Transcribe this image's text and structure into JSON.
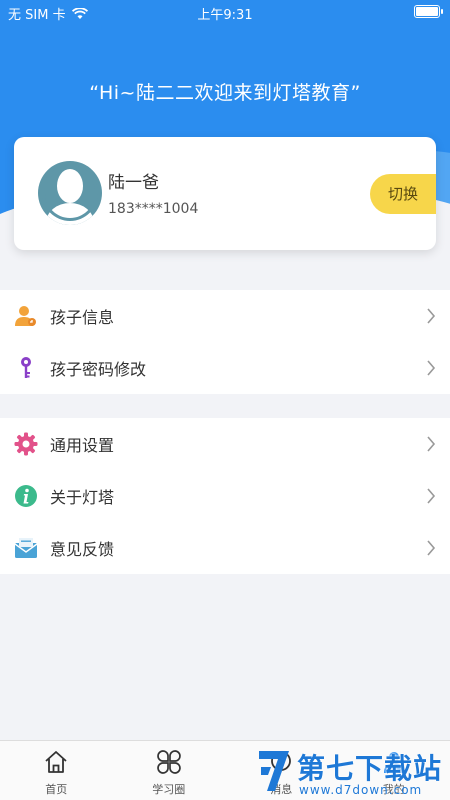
{
  "status_bar": {
    "carrier": "无 SIM 卡",
    "time": "上午9:31"
  },
  "header": {
    "welcome": "“Hi~陆二二欢迎来到灯塔教育”"
  },
  "profile": {
    "name": "陆一爸",
    "phone": "183****1004",
    "switch_label": "切换"
  },
  "menu_group_1": [
    {
      "label": "孩子信息",
      "icon": "child-info-icon"
    },
    {
      "label": "孩子密码修改",
      "icon": "key-icon"
    }
  ],
  "menu_group_2": [
    {
      "label": "通用设置",
      "icon": "gear-icon"
    },
    {
      "label": "关于灯塔",
      "icon": "info-icon"
    },
    {
      "label": "意见反馈",
      "icon": "feedback-icon"
    }
  ],
  "tabs": [
    {
      "label": "首页",
      "icon": "home-icon"
    },
    {
      "label": "学习圈",
      "icon": "clover-icon"
    },
    {
      "label": "消息",
      "icon": "message-icon"
    },
    {
      "label": "我的",
      "icon": "profile-icon"
    }
  ],
  "watermark": {
    "title": "第七下载站",
    "url": "www.d7down.com"
  },
  "colors": {
    "header_blue": "#2b8def",
    "switch_yellow": "#f7d64a",
    "watermark_blue": "#1e78d6"
  }
}
